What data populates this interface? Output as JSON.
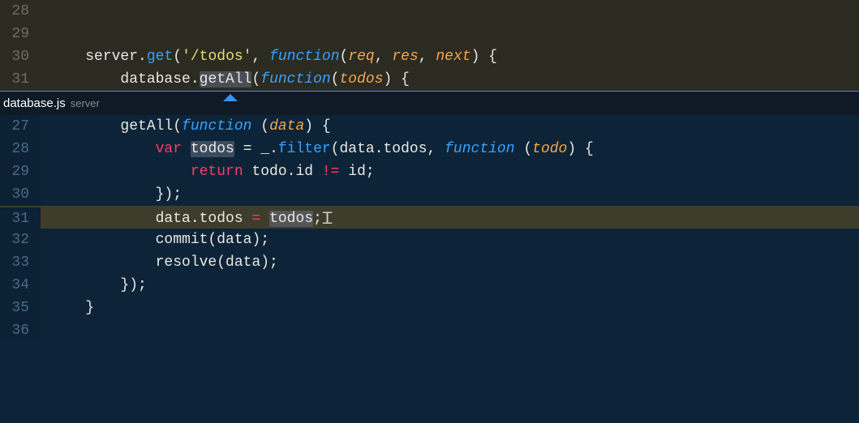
{
  "top_editor": {
    "lines": [
      {
        "num": "28",
        "tokens": []
      },
      {
        "num": "29",
        "tokens": []
      },
      {
        "num": "30",
        "tokens": [
          {
            "t": "server",
            "c": "tok-ident"
          },
          {
            "t": ".",
            "c": "tok-ident"
          },
          {
            "t": "get",
            "c": "tok-builtin"
          },
          {
            "t": "(",
            "c": "tok-ident"
          },
          {
            "t": "'/todos'",
            "c": "tok-str"
          },
          {
            "t": ", ",
            "c": "tok-ident"
          },
          {
            "t": "function",
            "c": "tok-fn"
          },
          {
            "t": "(",
            "c": "tok-ident"
          },
          {
            "t": "req",
            "c": "tok-param"
          },
          {
            "t": ", ",
            "c": "tok-ident"
          },
          {
            "t": "res",
            "c": "tok-param"
          },
          {
            "t": ", ",
            "c": "tok-ident"
          },
          {
            "t": "next",
            "c": "tok-param"
          },
          {
            "t": ") {",
            "c": "tok-ident"
          }
        ],
        "indent": "    "
      },
      {
        "num": "31",
        "tokens": [
          {
            "t": "database.",
            "c": "tok-ident"
          },
          {
            "t": "getAll",
            "c": "tok-ident tok-hl-word"
          },
          {
            "t": "(",
            "c": "tok-ident"
          },
          {
            "t": "function",
            "c": "tok-fn"
          },
          {
            "t": "(",
            "c": "tok-ident"
          },
          {
            "t": "todos",
            "c": "tok-param"
          },
          {
            "t": ") {",
            "c": "tok-ident"
          }
        ],
        "indent": "        "
      }
    ]
  },
  "peek": {
    "file": "database.js",
    "location": "server",
    "lines": [
      {
        "num": "27",
        "indent": "        ",
        "tokens": [
          {
            "t": "getAll(",
            "c": "tok-ident"
          },
          {
            "t": "function",
            "c": "tok-fn"
          },
          {
            "t": " (",
            "c": "tok-ident"
          },
          {
            "t": "data",
            "c": "tok-param"
          },
          {
            "t": ") {",
            "c": "tok-ident"
          }
        ]
      },
      {
        "num": "28",
        "indent": "            ",
        "tokens": [
          {
            "t": "var",
            "c": "tok-kw"
          },
          {
            "t": " ",
            "c": "tok-ident"
          },
          {
            "t": "todos",
            "c": "tok-ident tok-hl-word"
          },
          {
            "t": " = _.",
            "c": "tok-ident"
          },
          {
            "t": "filter",
            "c": "tok-builtin"
          },
          {
            "t": "(data.todos, ",
            "c": "tok-ident"
          },
          {
            "t": "function",
            "c": "tok-fn"
          },
          {
            "t": " (",
            "c": "tok-ident"
          },
          {
            "t": "todo",
            "c": "tok-param"
          },
          {
            "t": ") {",
            "c": "tok-ident"
          }
        ]
      },
      {
        "num": "29",
        "indent": "                ",
        "tokens": [
          {
            "t": "return",
            "c": "tok-kw"
          },
          {
            "t": " todo.id ",
            "c": "tok-ident"
          },
          {
            "t": "!=",
            "c": "tok-kw"
          },
          {
            "t": " id;",
            "c": "tok-ident"
          }
        ]
      },
      {
        "num": "30",
        "indent": "            ",
        "tokens": [
          {
            "t": "});",
            "c": "tok-ident"
          }
        ]
      },
      {
        "num": "31",
        "indent": "            ",
        "current": true,
        "tokens": [
          {
            "t": "data.todos ",
            "c": "tok-ident"
          },
          {
            "t": "=",
            "c": "tok-kw"
          },
          {
            "t": " ",
            "c": "tok-ident"
          },
          {
            "t": "todos",
            "c": "tok-ident tok-hl-word"
          },
          {
            "t": ";",
            "c": "tok-ident"
          },
          {
            "t": "CURSOR",
            "c": "caret"
          }
        ]
      },
      {
        "num": "32",
        "indent": "            ",
        "tokens": [
          {
            "t": "commit(data);",
            "c": "tok-ident"
          }
        ]
      },
      {
        "num": "33",
        "indent": "            ",
        "tokens": [
          {
            "t": "resolve(data);",
            "c": "tok-ident"
          }
        ]
      },
      {
        "num": "34",
        "indent": "        ",
        "tokens": [
          {
            "t": "});",
            "c": "tok-ident"
          }
        ]
      },
      {
        "num": "35",
        "indent": "    ",
        "tokens": [
          {
            "t": "}",
            "c": "tok-ident"
          }
        ]
      },
      {
        "num": "36",
        "indent": "",
        "tokens": []
      }
    ]
  },
  "icons": {
    "caret_glyph": "Ꮖ"
  }
}
